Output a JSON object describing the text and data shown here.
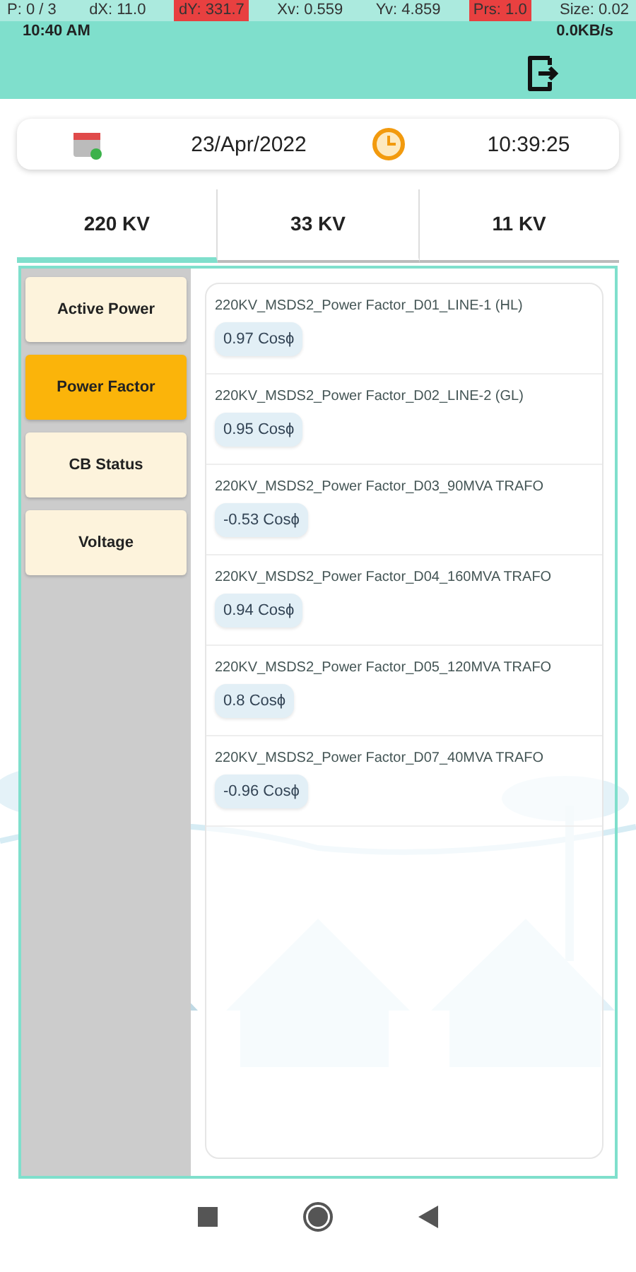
{
  "pointer_overlay": [
    {
      "text": "P: 0 / 3",
      "highlighted": false
    },
    {
      "text": "dX: 11.0",
      "highlighted": false
    },
    {
      "text": "dY: 331.7",
      "highlighted": true
    },
    {
      "text": "Xv: 0.559",
      "highlighted": false
    },
    {
      "text": "Yv: 4.859",
      "highlighted": false
    },
    {
      "text": "Prs: 1.0",
      "highlighted": true
    },
    {
      "text": "Size: 0.02",
      "highlighted": false
    }
  ],
  "status_bar": {
    "time": "10:40 AM",
    "network_speed": "0.0KB/s"
  },
  "date_bar": {
    "date": "23/Apr/2022",
    "time": "10:39:25"
  },
  "tabs": [
    {
      "label": "220 KV",
      "selected": true
    },
    {
      "label": "33 KV",
      "selected": false
    },
    {
      "label": "11 KV",
      "selected": false
    }
  ],
  "sidebar": {
    "items": [
      {
        "label": "Active Power",
        "selected": false
      },
      {
        "label": "Power Factor",
        "selected": true
      },
      {
        "label": "CB Status",
        "selected": false
      },
      {
        "label": "Voltage",
        "selected": false
      }
    ]
  },
  "readings": [
    {
      "name": "220KV_MSDS2_Power Factor_D01_LINE-1 (HL)",
      "value": "0.97 Cosϕ"
    },
    {
      "name": "220KV_MSDS2_Power Factor_D02_LINE-2 (GL)",
      "value": "0.95 Cosϕ"
    },
    {
      "name": "220KV_MSDS2_Power Factor_D03_90MVA TRAFO",
      "value": "-0.53 Cosϕ"
    },
    {
      "name": "220KV_MSDS2_Power Factor_D04_160MVA TRAFO",
      "value": "0.94 Cosϕ"
    },
    {
      "name": "220KV_MSDS2_Power Factor_D05_120MVA TRAFO",
      "value": "0.8 Cosϕ"
    },
    {
      "name": "220KV_MSDS2_Power Factor_D07_40MVA TRAFO",
      "value": "-0.96 Cosϕ"
    }
  ]
}
